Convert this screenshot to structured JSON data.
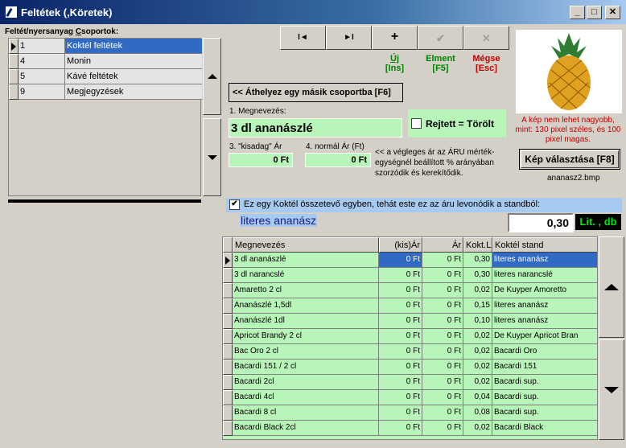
{
  "window": {
    "title": "Feltétek (,Köretek)"
  },
  "groups": {
    "label_prefix": "Feltét/nyersanyag ",
    "label_underlined": "C",
    "label_rest": "soportok:",
    "rows": [
      {
        "num": "1",
        "name": "Koktél feltétek",
        "selected": true
      },
      {
        "num": "4",
        "name": "Monin"
      },
      {
        "num": "5",
        "name": "Kávé feltétek"
      },
      {
        "num": "9",
        "name": "Megjegyzések"
      }
    ]
  },
  "nav": {
    "first_glyph": "I◄",
    "last_glyph": "►I",
    "new_glyph": "+",
    "save_glyph": "✔",
    "cancel_glyph": "✕",
    "new_label": "Új",
    "new_key": "[Ins]",
    "save_label": "Elment",
    "save_key": "[F5]",
    "cancel_label": "Mégse",
    "cancel_key": "[Esc]"
  },
  "move_button": "<< Áthelyez egy másik csoportba [F6]",
  "name_field": {
    "label": "1. Megnevezés:",
    "value": "3 dl ananászlé"
  },
  "hidden_checkbox": {
    "label": "Rejtett = Törölt",
    "checked": false
  },
  "small_price": {
    "label": "3. \"kisadag\" Ár",
    "value": "0 Ft"
  },
  "normal_price": {
    "label": "4. normál Ár (Ft)",
    "value": "0 Ft"
  },
  "price_note": "<< a végleges ár az ÁRU mérték-egységnél beállított % arányában szorzódik és kerekítődik.",
  "image": {
    "note": "A kép nem lehet nagyobb, mint: 130 pixel széles, és 100 pixel magas.",
    "button": "Kép választása [F8]",
    "filename": "ananasz2.bmp"
  },
  "cocktail": {
    "checkbox_label": "Ez egy Koktél összetevő egyben, tehát este ez az áru levonódik a standból:",
    "checked": true,
    "ingredient": "literes ananász",
    "quantity": "0,30",
    "unit": "Lit. , db"
  },
  "table": {
    "columns": [
      "Megnevezés",
      "(kis)Ár",
      "Ár",
      "Kokt.L.",
      "Koktél stand"
    ],
    "rows": [
      [
        "3 dl ananászlé",
        "0 Ft",
        "0 Ft",
        "0,30",
        "literes ananász"
      ],
      [
        "3 dl narancslé",
        "0 Ft",
        "0 Ft",
        "0,30",
        "literes narancslé"
      ],
      [
        "Amaretto 2 cl",
        "0 Ft",
        "0 Ft",
        "0,02",
        "De Kuyper Amoretto"
      ],
      [
        "Ananászlé 1,5dl",
        "0 Ft",
        "0 Ft",
        "0,15",
        "literes ananász"
      ],
      [
        "Ananászlé 1dl",
        "0 Ft",
        "0 Ft",
        "0,10",
        "literes ananász"
      ],
      [
        "Apricot Brandy 2 cl",
        "0 Ft",
        "0 Ft",
        "0,02",
        "De Kuyper Apricot Bran"
      ],
      [
        "Bac Oro 2 cl",
        "0 Ft",
        "0 Ft",
        "0,02",
        "Bacardi Oro"
      ],
      [
        "Bacardi 151 / 2 cl",
        "0 Ft",
        "0 Ft",
        "0,02",
        "Bacardi 151"
      ],
      [
        "Bacardi 2cl",
        "0 Ft",
        "0 Ft",
        "0,02",
        "Bacardi sup."
      ],
      [
        "Bacardi 4cl",
        "0 Ft",
        "0 Ft",
        "0,04",
        "Bacardi sup."
      ],
      [
        "Bacardi 8 cl",
        "0 Ft",
        "0 Ft",
        "0,08",
        "Bacardi sup."
      ],
      [
        "Bacardi Black 2cl",
        "0 Ft",
        "0 Ft",
        "0,02",
        "Bacardi Black"
      ]
    ]
  },
  "colors": {
    "field_green": "#b8f5b8",
    "selection_blue": "#316ac5",
    "save_green": "#008000",
    "cancel_red": "#c00000"
  }
}
